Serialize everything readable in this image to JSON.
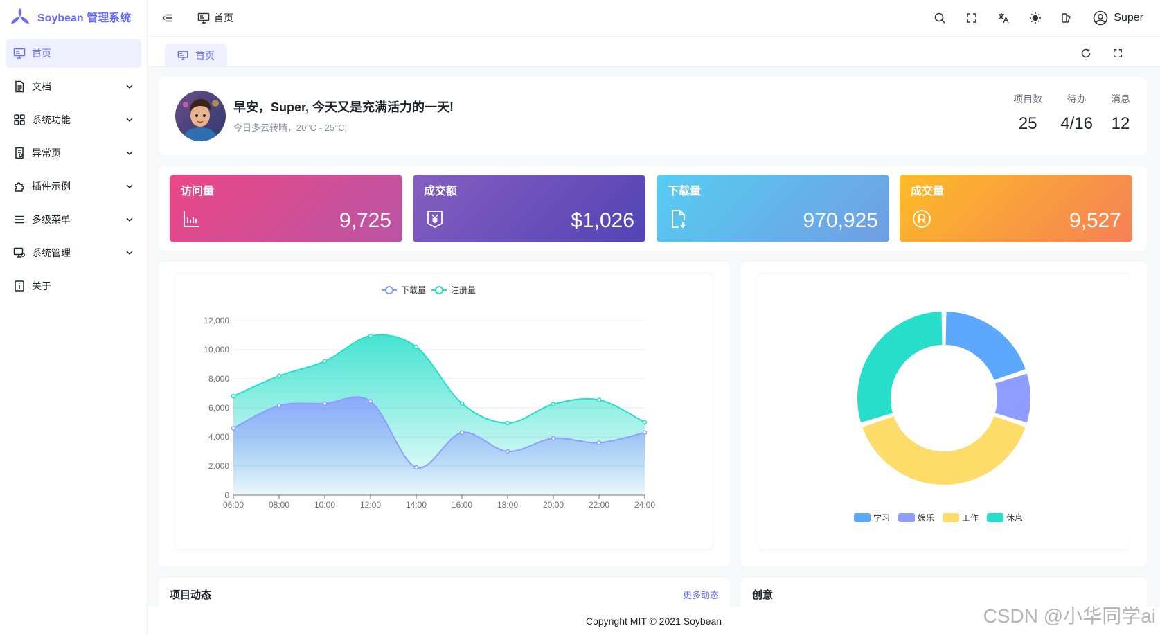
{
  "app": {
    "title": "Soybean 管理系统"
  },
  "sidebar": {
    "items": [
      {
        "label": "首页",
        "icon": "monitor-icon",
        "active": true
      },
      {
        "label": "文档",
        "icon": "document-icon",
        "expandable": true
      },
      {
        "label": "系统功能",
        "icon": "grid-icon",
        "expandable": true
      },
      {
        "label": "异常页",
        "icon": "file-warning-icon",
        "expandable": true
      },
      {
        "label": "插件示例",
        "icon": "puzzle-icon",
        "expandable": true
      },
      {
        "label": "多级菜单",
        "icon": "menu-lines-icon",
        "expandable": true
      },
      {
        "label": "系统管理",
        "icon": "monitor-settings-icon",
        "expandable": true
      },
      {
        "label": "关于",
        "icon": "info-icon"
      }
    ]
  },
  "header": {
    "breadcrumb": "首页",
    "user": "Super"
  },
  "tabs": [
    {
      "label": "首页",
      "active": true
    }
  ],
  "welcome": {
    "greeting": "早安，Super, 今天又是充满活力的一天!",
    "weather": "今日多云转晴，20°C - 25°C!",
    "stats": [
      {
        "label": "项目数",
        "value": "25"
      },
      {
        "label": "待办",
        "value": "4/16"
      },
      {
        "label": "消息",
        "value": "12"
      }
    ]
  },
  "kpis": [
    {
      "title": "访问量",
      "value": "9,725",
      "icon": "bar-chart-icon",
      "from": "#ec4786",
      "to": "#b955a4"
    },
    {
      "title": "成交额",
      "value": "$1,026",
      "icon": "yen-icon",
      "from": "#865ec0",
      "to": "#5144b4"
    },
    {
      "title": "下载量",
      "value": "970,925",
      "icon": "file-download-icon",
      "from": "#56cdf3",
      "to": "#719de3"
    },
    {
      "title": "成交量",
      "value": "9,527",
      "icon": "registered-icon",
      "from": "#fcbc25",
      "to": "#f68057"
    }
  ],
  "chart_data": [
    {
      "type": "area",
      "x": [
        "06:00",
        "08:00",
        "10:00",
        "12:00",
        "14:00",
        "16:00",
        "18:00",
        "20:00",
        "22:00",
        "24:00"
      ],
      "ylim": [
        0,
        12000
      ],
      "yticks": [
        "0",
        "2,000",
        "4,000",
        "6,000",
        "8,000",
        "10,000",
        "12,000"
      ],
      "grid": true,
      "legend": "top",
      "series": [
        {
          "name": "下载量",
          "color": "#8e9dff",
          "values": [
            4600,
            6150,
            6300,
            6450,
            1900,
            4300,
            3000,
            3900,
            3600,
            4300
          ]
        },
        {
          "name": "注册量",
          "color": "#26deca",
          "values": [
            6800,
            8200,
            9200,
            10950,
            10200,
            6300,
            4950,
            6250,
            6550,
            5000
          ]
        }
      ]
    },
    {
      "type": "pie",
      "legend": "bottom",
      "series": [
        {
          "name": "学习",
          "value": 20,
          "color": "#5da8ff"
        },
        {
          "name": "娱乐",
          "value": 10,
          "color": "#8e9dff"
        },
        {
          "name": "工作",
          "value": 40,
          "color": "#fedc69"
        },
        {
          "name": "休息",
          "value": 30,
          "color": "#26deca"
        }
      ]
    }
  ],
  "sections": {
    "project_news": "项目动态",
    "more_news": "更多动态",
    "creativity": "创意"
  },
  "footer": "Copyright MIT © 2021 Soybean",
  "watermark": "CSDN @小华同学ai"
}
